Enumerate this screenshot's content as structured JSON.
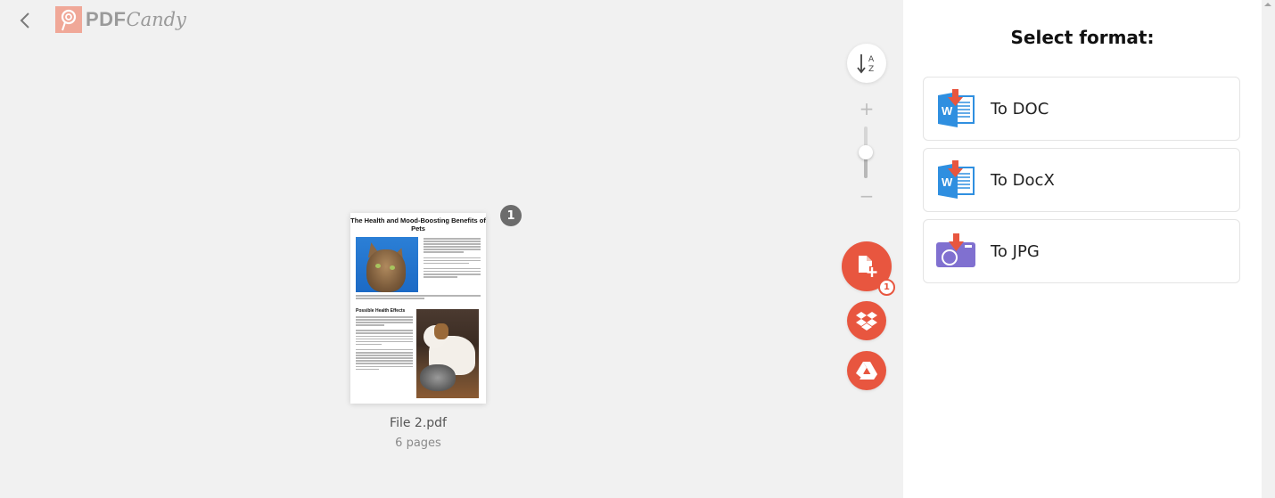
{
  "header": {
    "back_icon": "chevron-left-icon",
    "logo": {
      "part1": "PDF",
      "part2": "Candy",
      "mark_icon": "lollipop-icon"
    }
  },
  "controls": {
    "sort_icon": "sort-alpha-down-icon",
    "sort_a": "A",
    "sort_z": "Z",
    "zoom_in_label": "+",
    "zoom_out_label": "−",
    "zoom_level": 0.5,
    "add_files_icon": "file-plus-icon",
    "add_files_badge": "1",
    "dropbox_icon": "dropbox-icon",
    "gdrive_icon": "google-drive-icon",
    "accent_color": "#e8563f"
  },
  "file": {
    "index_badge": "1",
    "name": "File 2.pdf",
    "pages": "6 pages",
    "preview": {
      "title": "The Health and Mood-Boosting Benefits of Pets",
      "subheading": "Possible Health Effects"
    }
  },
  "format_panel": {
    "title": "Select format:",
    "options": [
      {
        "label": "To DOC",
        "icon": "word-download-icon"
      },
      {
        "label": "To DocX",
        "icon": "word-download-icon"
      },
      {
        "label": "To JPG",
        "icon": "image-download-icon"
      }
    ]
  }
}
